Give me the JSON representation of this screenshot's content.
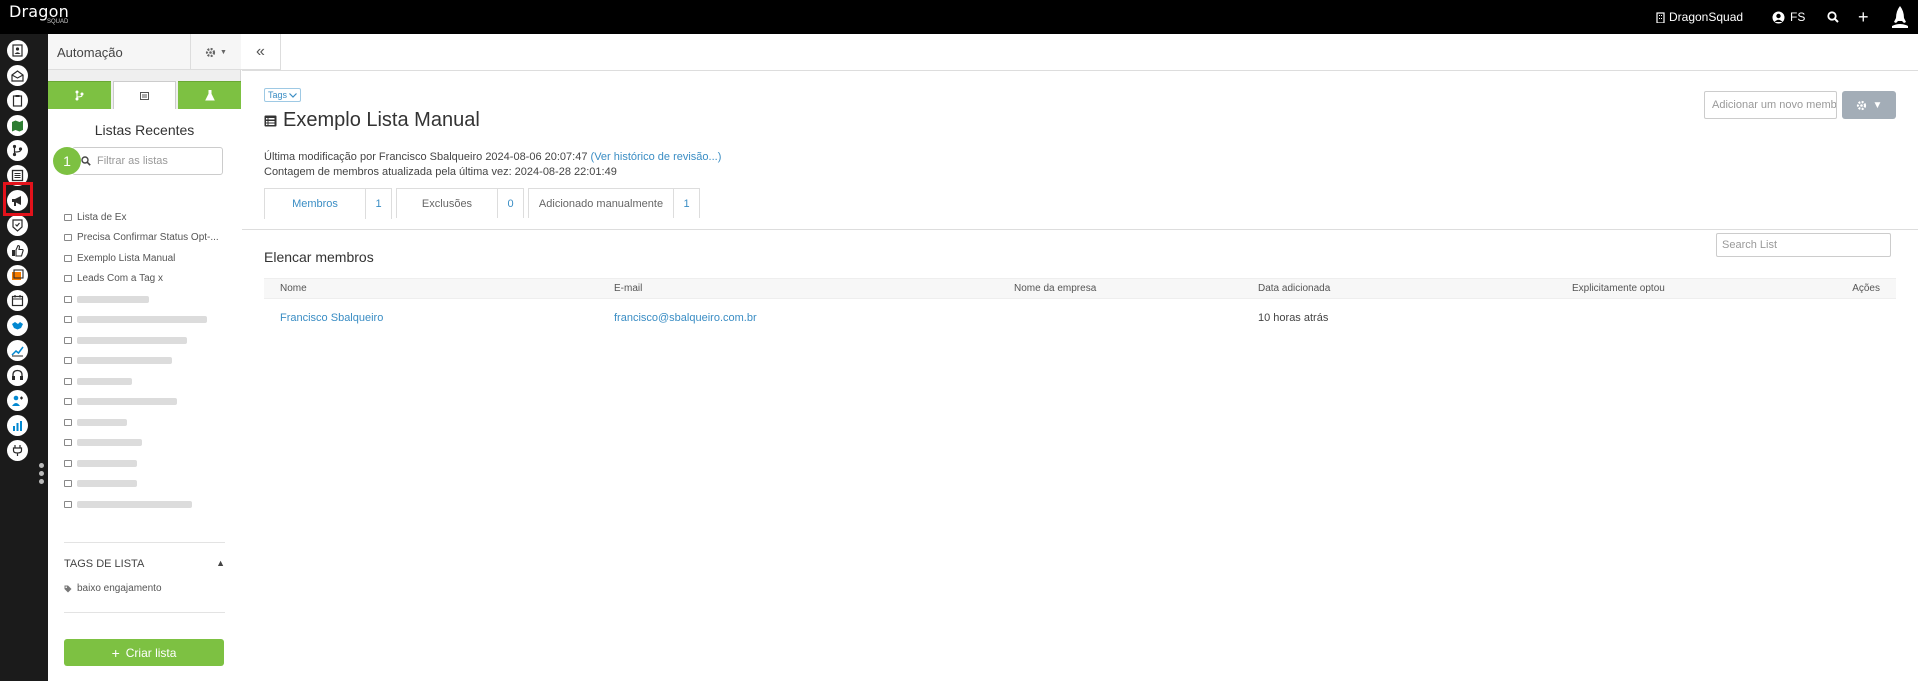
{
  "topbar": {
    "logo": "Dragon",
    "logo_sub": "SQUAD",
    "org_name": "DragonSquad",
    "user_initials": "FS"
  },
  "sidebar_icons": [
    "contacts-icon",
    "inbox-icon",
    "clipboard-icon",
    "map-icon",
    "workflow-icon",
    "list-icon",
    "megaphone-icon",
    "badge-icon",
    "thumbs-up-icon",
    "gallery-icon",
    "calendar-icon",
    "handshake-icon",
    "chart-up-icon",
    "headset-icon",
    "user-add-icon",
    "bar-chart-icon",
    "plug-icon"
  ],
  "panel": {
    "title": "Automação",
    "collapse_glyph": "«",
    "heading": "Listas Recentes",
    "filter_placeholder": "Filtrar as listas",
    "step_badge": "1",
    "lists": [
      "Lista de Ex",
      "Precisa Confirmar Status Opt-...",
      "Exemplo Lista Manual",
      "Leads Com a Tag x"
    ],
    "tags_heading": "TAGS DE LISTA",
    "tags": [
      "baixo engajamento"
    ],
    "create_label": "Criar lista"
  },
  "main": {
    "tags_label": "Tags",
    "title": "Exemplo Lista Manual",
    "meta_line1": "Última modificação por Francisco Sbalqueiro 2024-08-06 20:07:47",
    "meta_link": "(Ver histórico de revisão...)",
    "meta_line2": "Contagem de membros atualizada pela última vez: 2024-08-28 22:01:49",
    "add_member_placeholder": "Adicionar um novo membro",
    "tabs": [
      {
        "label": "Membros",
        "count": "1"
      },
      {
        "label": "Exclusões",
        "count": "0"
      },
      {
        "label": "Adicionado manualmente",
        "count": "1"
      }
    ],
    "section_title": "Elencar membros",
    "search_placeholder": "Search List",
    "columns": [
      "Nome",
      "E-mail",
      "Nome da empresa",
      "Data adicionada",
      "Explicitamente optou",
      "Ações"
    ],
    "rows": [
      {
        "name": "Francisco Sbalqueiro",
        "email": "francisco@sbalqueiro.com.br",
        "company": "",
        "date": "10 horas atrás",
        "opted": ""
      }
    ]
  },
  "colors": {
    "green": "#7dc142",
    "link": "#3a8dc4",
    "highlight": "#e3121b"
  }
}
